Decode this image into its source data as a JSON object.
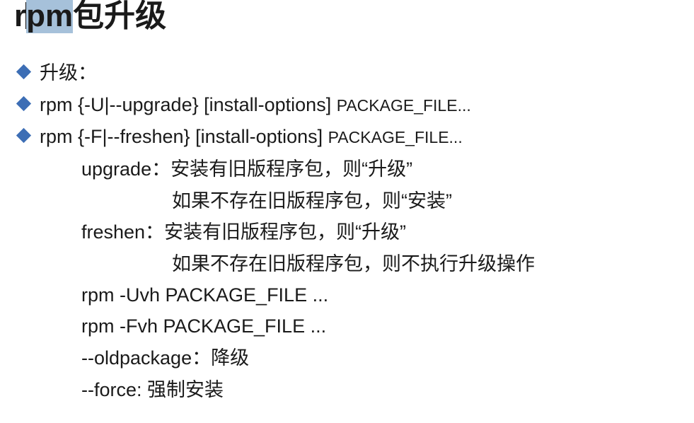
{
  "slide": {
    "title_part1": "r",
    "title_part2": "pm",
    "title_part3": "包升级",
    "bullets": [
      {
        "text": "升级：",
        "small": ""
      },
      {
        "text": "rpm {-U|--upgrade} [install-options] ",
        "small": "PACKAGE_FILE..."
      },
      {
        "text": "rpm {-F|--freshen} [install-options] ",
        "small": "PACKAGE_FILE..."
      }
    ],
    "details": {
      "upgrade_line": "upgrade：安装有旧版程序包，则“升级”",
      "upgrade_cont": "如果不存在旧版程序包，则“安装”",
      "freshen_line": "freshen：安装有旧版程序包，则“升级”",
      "freshen_cont": "如果不存在旧版程序包，则不执行升级操作",
      "uvh": "rpm -Uvh PACKAGE_FILE ...",
      "fvh": "rpm -Fvh PACKAGE_FILE ...",
      "oldpackage": "--oldpackage：降级",
      "force": "--force: 强制安装"
    },
    "accent_color": "#3d6eb5",
    "highlight_color": "#a6c1da"
  }
}
